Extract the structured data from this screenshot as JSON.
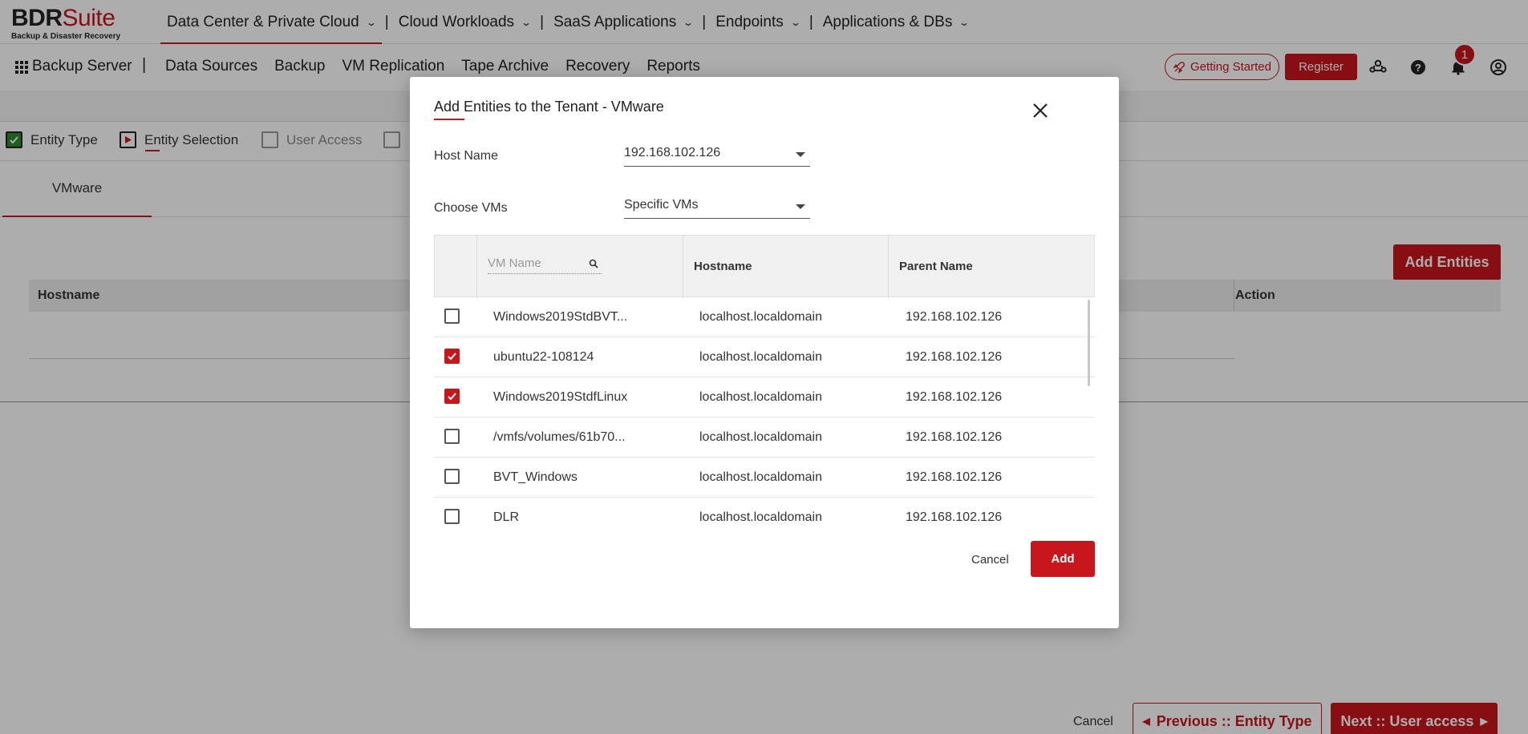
{
  "brand": {
    "name_black": "BDR",
    "name_red": "Suite",
    "tagline": "Backup & Disaster Recovery"
  },
  "top_nav": [
    {
      "label": "Data Center & Private Cloud",
      "active": true
    },
    {
      "label": "Cloud Workloads"
    },
    {
      "label": "SaaS Applications"
    },
    {
      "label": "Endpoints"
    },
    {
      "label": "Applications & DBs"
    }
  ],
  "top_nav_separator": "|",
  "sub_header": {
    "app_label": "Backup Server",
    "separator": "|",
    "nav": [
      "Data Sources",
      "Backup",
      "VM Replication",
      "Tape Archive",
      "Recovery",
      "Reports"
    ],
    "getting_started_label": "Getting Started",
    "register_label": "Register",
    "notification_count": "1",
    "icons": [
      "users-icon",
      "help-icon",
      "bell-icon",
      "account-icon"
    ]
  },
  "steps": [
    {
      "label": "Entity Type",
      "state": "done"
    },
    {
      "label": "Entity Selection",
      "state": "current"
    },
    {
      "label": "User Access",
      "state": "pending"
    }
  ],
  "tabs": [
    "VMware"
  ],
  "background_table": {
    "add_button_label": "Add Entities",
    "columns": [
      "Hostname",
      "Action"
    ]
  },
  "footer": {
    "cancel_label": "Cancel",
    "previous_label": "Previous :: Entity Type",
    "next_label": "Next :: User access"
  },
  "modal": {
    "title": "Add Entities to the Tenant - VMware",
    "host_name_label": "Host Name",
    "host_name_value": "192.168.102.126",
    "choose_vms_label": "Choose VMs",
    "choose_vms_value": "Specific VMs",
    "search_placeholder": "VM Name",
    "columns": [
      "Hostname",
      "Parent Name"
    ],
    "rows": [
      {
        "checked": false,
        "vm_name": "Windows2019StdBVT...",
        "hostname": "localhost.localdomain",
        "parent": "192.168.102.126"
      },
      {
        "checked": true,
        "vm_name": "ubuntu22-108124",
        "hostname": "localhost.localdomain",
        "parent": "192.168.102.126"
      },
      {
        "checked": true,
        "vm_name": "Windows2019StdfLinux",
        "hostname": "localhost.localdomain",
        "parent": "192.168.102.126"
      },
      {
        "checked": false,
        "vm_name": "/vmfs/volumes/61b70...",
        "hostname": "localhost.localdomain",
        "parent": "192.168.102.126"
      },
      {
        "checked": false,
        "vm_name": "BVT_Windows",
        "hostname": "localhost.localdomain",
        "parent": "192.168.102.126"
      },
      {
        "checked": false,
        "vm_name": "DLR",
        "hostname": "localhost.localdomain",
        "parent": "192.168.102.126"
      }
    ],
    "cancel_label": "Cancel",
    "add_label": "Add"
  },
  "colors": {
    "accent": "#c8161d",
    "step_done": "#2e8b2e"
  }
}
